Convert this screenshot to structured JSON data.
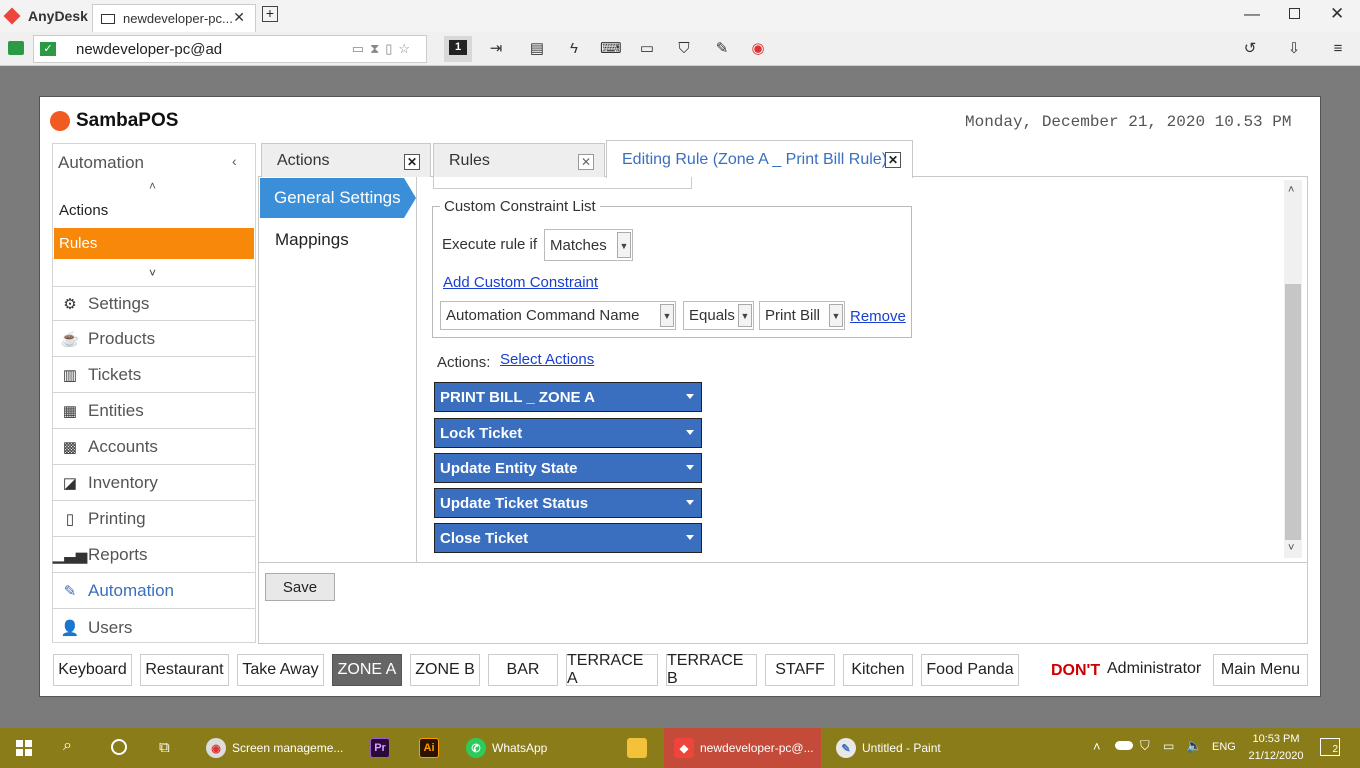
{
  "anydesk": {
    "app_name": "AnyDesk",
    "tab_title": "newdeveloper-pc...",
    "address": "newdeveloper-pc@ad",
    "monitor_number": "1"
  },
  "samba": {
    "logo": "SambaPOS",
    "datetime": "Monday, December 21, 2020 10.53 PM",
    "nav": {
      "header": "Automation",
      "sub_items": [
        "Actions",
        "Rules"
      ],
      "items": [
        "Settings",
        "Products",
        "Tickets",
        "Entities",
        "Accounts",
        "Inventory",
        "Printing",
        "Reports",
        "Automation",
        "Users"
      ]
    },
    "tabs": {
      "actions": "Actions",
      "rules": "Rules",
      "editing": "Editing Rule (Zone A _ Print Bill Rule)"
    },
    "left_panel": {
      "general": "General Settings",
      "mappings": "Mappings"
    },
    "constraints": {
      "legend": "Custom Constraint List",
      "execute_label": "Execute rule if",
      "execute_value": "Matches",
      "add_link": "Add Custom Constraint",
      "field": "Automation Command Name",
      "operator": "Equals",
      "value": "Print Bill",
      "remove": "Remove"
    },
    "actions_label": "Actions:",
    "select_actions": "Select Actions",
    "action_items": [
      "PRINT BILL _ ZONE A",
      "Lock Ticket",
      "Update Entity State",
      "Update Ticket Status",
      "Close Ticket"
    ],
    "save": "Save",
    "zones": [
      "Keyboard",
      "Restaurant",
      "Take Away",
      "ZONE A",
      "ZONE B",
      "BAR",
      "TERRACE A",
      "TERRACE B",
      "STAFF",
      "Kitchen",
      "Food Panda"
    ],
    "dont": "DON'T",
    "user": "Administrator",
    "main_menu": "Main Menu",
    "active_zone_color": "#666666",
    "accent_orange": "#f7880a",
    "accent_blue": "#3a8fd8"
  },
  "taskbar": {
    "items": [
      "Screen manageme...",
      "WhatsApp",
      "newdeveloper-pc@...",
      "Untitled - Paint"
    ],
    "lang": "ENG",
    "time": "10:53 PM",
    "date": "21/12/2020",
    "notif_count": "2"
  }
}
